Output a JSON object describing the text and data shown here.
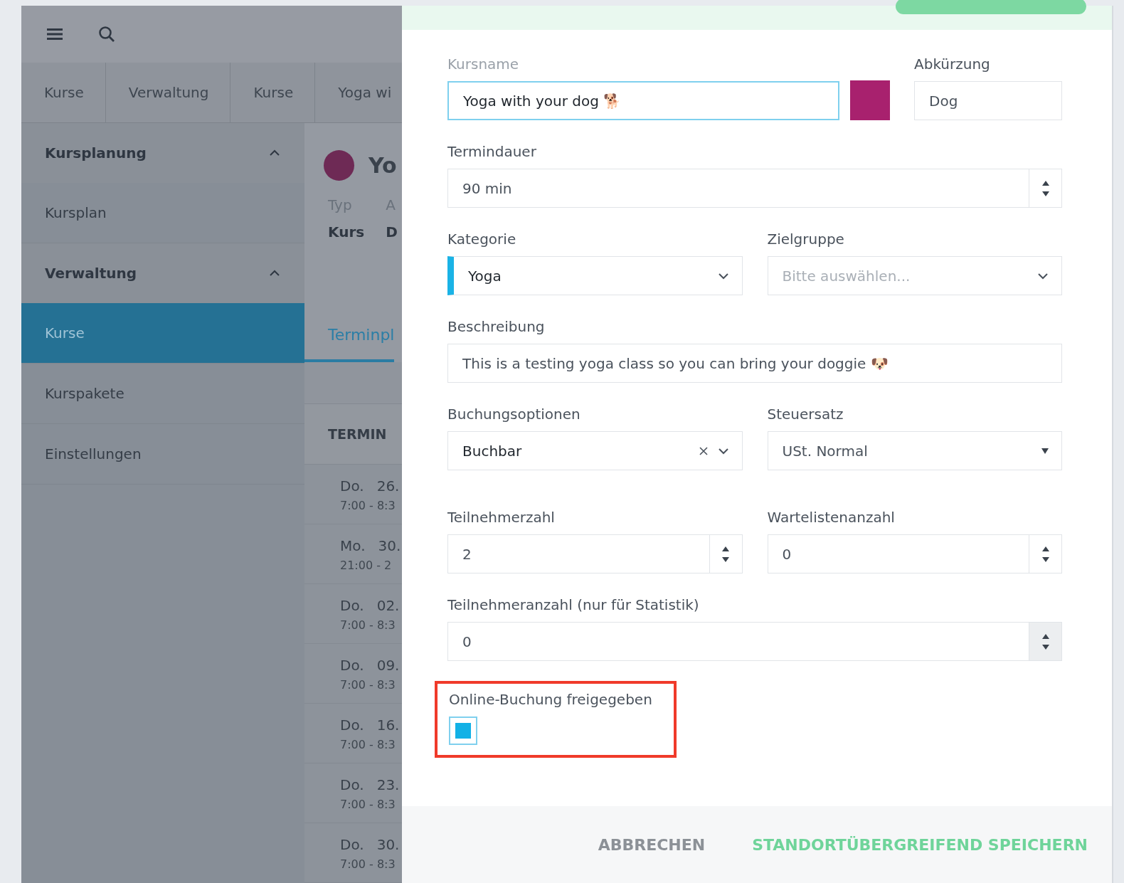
{
  "breadcrumbs": [
    "Kurse",
    "Verwaltung",
    "Kurse",
    "Yoga wi"
  ],
  "sidebar": {
    "sections": [
      {
        "title": "Kursplanung",
        "expanded": true,
        "items": [
          {
            "label": "Kursplan",
            "selected": false
          }
        ]
      },
      {
        "title": "Verwaltung",
        "expanded": true,
        "items": [
          {
            "label": "Kurse",
            "selected": true
          },
          {
            "label": "Kurspakete",
            "selected": false
          },
          {
            "label": "Einstellungen",
            "selected": false
          }
        ]
      }
    ]
  },
  "course": {
    "color": "#6e2a55",
    "title": "Yo",
    "meta": [
      {
        "label": "Typ",
        "value": "Kurs"
      },
      {
        "label": "A",
        "value": "D"
      }
    ]
  },
  "tabs": [
    {
      "label": "Terminpl",
      "selected": true
    }
  ],
  "appointments": {
    "header": "TERMIN",
    "rows": [
      {
        "day": "Do.",
        "date": "26.",
        "time": "7:00 - 8:3"
      },
      {
        "day": "Mo.",
        "date": "30.",
        "time": "21:00 - 2"
      },
      {
        "day": "Do.",
        "date": "02.",
        "time": "7:00 - 8:3"
      },
      {
        "day": "Do.",
        "date": "09.",
        "time": "7:00 - 8:3"
      },
      {
        "day": "Do.",
        "date": "16.",
        "time": "7:00 - 8:3"
      },
      {
        "day": "Do.",
        "date": "23.",
        "time": "7:00 - 8:3"
      },
      {
        "day": "Do.",
        "date": "30.",
        "time": "7:00 - 8:3"
      }
    ]
  },
  "form": {
    "name": {
      "label": "Kursname",
      "value": "Yoga with your dog 🐕",
      "color": "#a8216e"
    },
    "abbreviation": {
      "label": "Abkürzung",
      "value": "Dog"
    },
    "duration": {
      "label": "Termindauer",
      "value": "90 min"
    },
    "category": {
      "label": "Kategorie",
      "value": "Yoga",
      "color": "#1ab3e6"
    },
    "audience": {
      "label": "Zielgruppe",
      "placeholder": "Bitte auswählen..."
    },
    "description": {
      "label": "Beschreibung",
      "value": "This is a testing yoga class so you can bring your doggie 🐶"
    },
    "booking": {
      "label": "Buchungsoptionen",
      "value": "Buchbar",
      "clearable": true
    },
    "tax": {
      "label": "Steuersatz",
      "value": "USt. Normal"
    },
    "participants": {
      "label": "Teilnehmerzahl",
      "value": "2"
    },
    "waitlist": {
      "label": "Wartelistenanzahl",
      "value": "0"
    },
    "statistics": {
      "label": "Teilnehmeranzahl (nur für Statistik)",
      "value": "0"
    },
    "online": {
      "label": "Online-Buchung freigegeben",
      "checked": true,
      "highlighted": true
    }
  },
  "footer": {
    "cancel": "ABBRECHEN",
    "save": "STANDORTÜBERGREIFEND SPEICHERN"
  }
}
